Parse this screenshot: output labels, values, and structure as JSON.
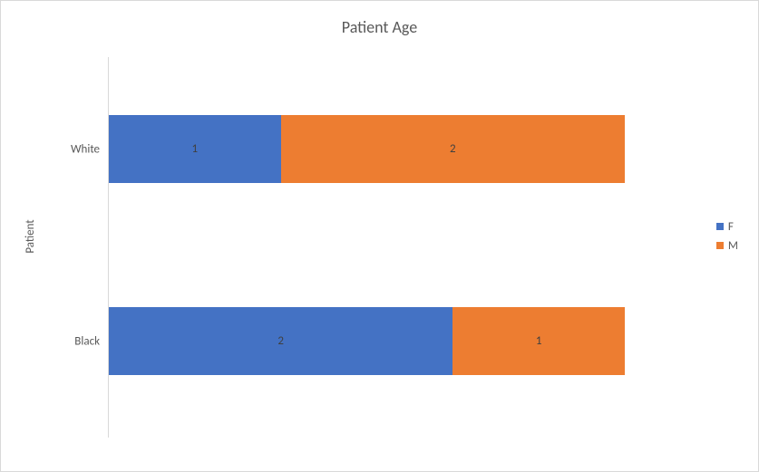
{
  "chart_data": {
    "type": "bar",
    "orientation": "horizontal",
    "stacked": true,
    "title": "Patient Age",
    "xlabel": "",
    "ylabel": "Patient",
    "categories": [
      "Black",
      "White"
    ],
    "series": [
      {
        "name": "F",
        "values": [
          2,
          1
        ],
        "color": "#4472C4"
      },
      {
        "name": "M",
        "values": [
          1,
          2
        ],
        "color": "#ED7D31"
      }
    ],
    "xlim": [
      0,
      3
    ],
    "legend_position": "right",
    "data_labels": true
  },
  "legend": {
    "f": "F",
    "m": "M"
  },
  "labels": {
    "white": "White",
    "black": "Black",
    "white_f": "1",
    "white_m": "2",
    "black_f": "2",
    "black_m": "1"
  }
}
